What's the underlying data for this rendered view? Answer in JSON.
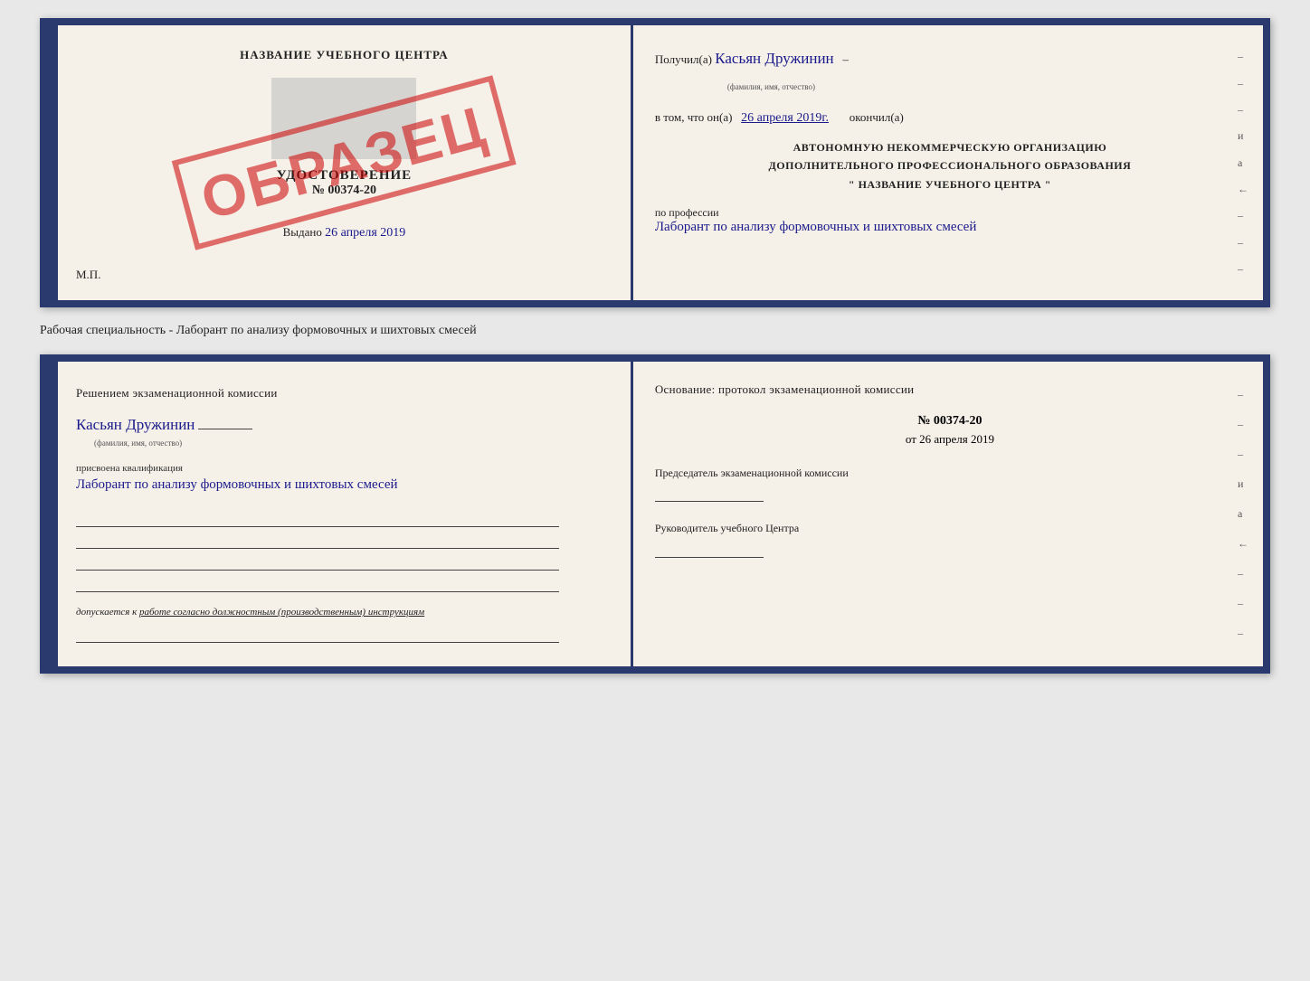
{
  "page": {
    "background": "#e8e8e8"
  },
  "top_book": {
    "left_page": {
      "title": "НАЗВАНИЕ УЧЕБНОГО ЦЕНТРА",
      "photo_placeholder": "",
      "udostoverenie_label": "УДОСТОВЕРЕНИЕ",
      "number": "№ 00374-20",
      "vydano_label": "Выдано",
      "vydano_date": "26 апреля 2019",
      "mp_label": "М.П.",
      "obrazets": "ОБРАЗЕЦ"
    },
    "right_page": {
      "poluchil_label": "Получил(а)",
      "recipient_name": "Касьян Дружинин",
      "fio_sublabel": "(фамилия, имя, отчество)",
      "vtom_label": "в том, что он(а)",
      "date_completed": "26 апреля 2019г.",
      "okonchil_label": "окончил(а)",
      "org_line1": "АВТОНОМНУЮ НЕКОММЕРЧЕСКУЮ ОРГАНИЗАЦИЮ",
      "org_line2": "ДОПОЛНИТЕЛЬНОГО ПРОФЕССИОНАЛЬНОГО ОБРАЗОВАНИЯ",
      "org_quote_open": "\"",
      "org_center_name": "НАЗВАНИЕ УЧЕБНОГО ЦЕНТРА",
      "org_quote_close": "\"",
      "po_professii_label": "по профессии",
      "profession_handwritten": "Лаборант по анализу формовочных и шихтовых смесей",
      "side_marks": [
        "-",
        "-",
        "-",
        "и",
        "а",
        "←",
        "-",
        "-",
        "-"
      ]
    }
  },
  "specialty_label": "Рабочая специальность - Лаборант по анализу формовочных и шихтовых смесей",
  "bottom_book": {
    "left_page": {
      "resheniem_label": "Решением экзаменационной комиссии",
      "name_handwritten": "Касьян Дружинин",
      "fio_sublabel": "(фамилия, имя, отчество)",
      "prisvoena_label": "присвоена квалификация",
      "kvalif_handwritten": "Лаборант по анализу формовочных и шихтовых смесей",
      "dopuskaetsya_label": "допускается к",
      "dopuskaetsya_text": "работе согласно должностным (производственным) инструкциям"
    },
    "right_page": {
      "osnovanie_label": "Основание: протокол экзаменационной комиссии",
      "protocol_number": "№ 00374-20",
      "ot_label": "от",
      "protocol_date": "26 апреля 2019",
      "predsedatel_label": "Председатель экзаменационной комиссии",
      "rukovoditel_label": "Руководитель учебного Центра",
      "side_marks": [
        "-",
        "-",
        "-",
        "и",
        "а",
        "←",
        "-",
        "-",
        "-"
      ]
    }
  }
}
